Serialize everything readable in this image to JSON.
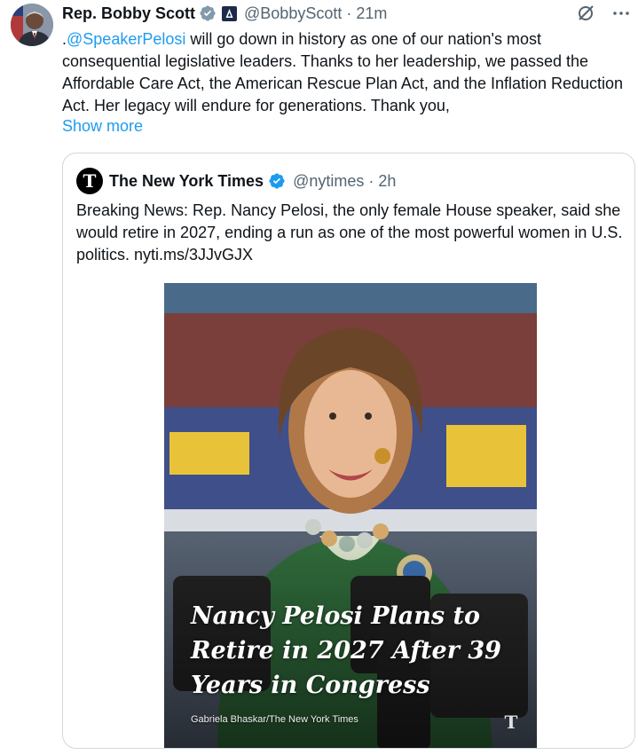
{
  "tweet": {
    "author_name": "Rep. Bobby Scott",
    "handle": "@BobbyScott",
    "separator": "·",
    "time": "21m",
    "mention": "@SpeakerPelosi",
    "text_prefix": ".",
    "text_rest": " will go down in history as one of our nation's most consequential legislative leaders. Thanks to her leadership, we passed the Affordable Care Act, the American Rescue Plan Act, and the Inflation Reduction Act. Her legacy will endure for generations. Thank you,",
    "show_more": "Show more",
    "icons": [
      "grok-slash-icon",
      "more-icon"
    ]
  },
  "quote": {
    "author_name": "The New York Times",
    "logo_letter": "T",
    "handle": "@nytimes",
    "separator": "·",
    "time": "2h",
    "text": "Breaking News: Rep. Nancy Pelosi, the only female House speaker, said she would retire in 2027, ending a run as one of the most powerful women in U.S. politics. nyti.ms/3JJvGJX",
    "image": {
      "headline": "Nancy Pelosi Plans to Retire in 2027 After 39 Years in Congress",
      "credit": "Gabriela Bhaskar/The New York Times",
      "watermark": "T"
    }
  },
  "colors": {
    "link": "#1d9bf0",
    "verified": "#1d9bf0",
    "muted": "#536471",
    "border": "#cfd9de"
  }
}
